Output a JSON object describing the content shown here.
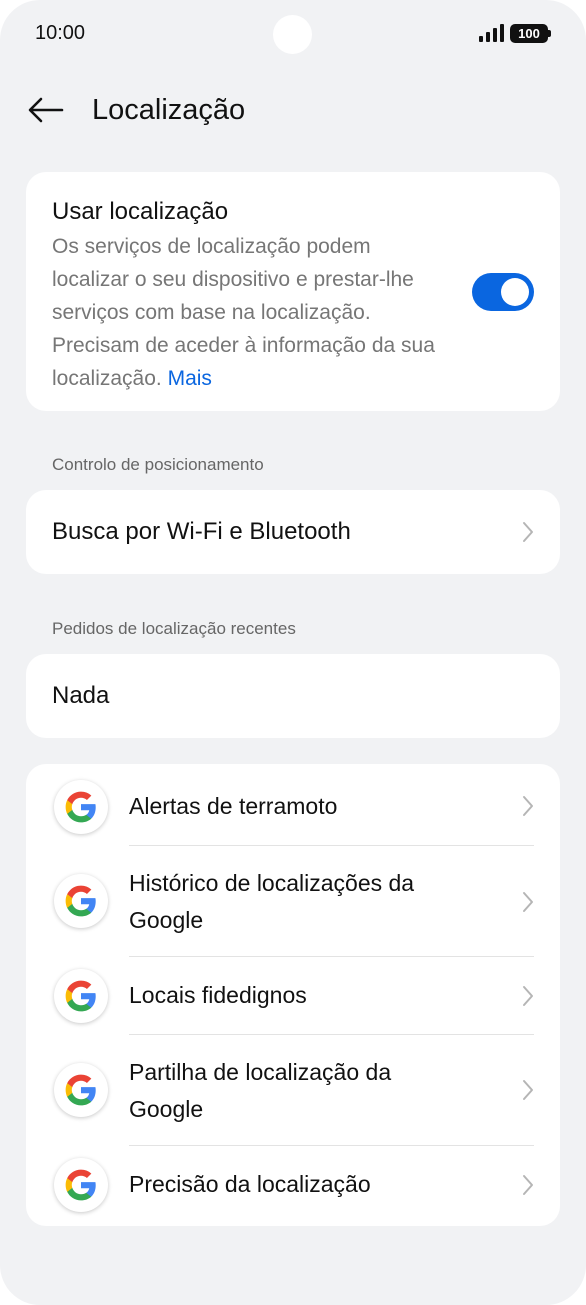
{
  "status_bar": {
    "time": "10:00",
    "battery": "100"
  },
  "header": {
    "title": "Localização"
  },
  "location_card": {
    "title": "Usar localização",
    "description": "Os serviços de localização podem localizar o seu dispositivo e prestar-lhe serviços com base na localização. Precisam de aceder à informação da sua localização.",
    "more_link": "Mais",
    "toggle_on": true
  },
  "sections": {
    "positioning_control": "Controlo de posicionamento",
    "recent_requests": "Pedidos de localização recentes"
  },
  "wifi_bluetooth_label": "Busca por Wi-Fi e Bluetooth",
  "recent_none_label": "Nada",
  "google_services": [
    {
      "label": "Alertas de terramoto"
    },
    {
      "label": "Histórico de localizações da Google"
    },
    {
      "label": "Locais fidedignos"
    },
    {
      "label": "Partilha de localização da Google"
    },
    {
      "label": "Precisão da localização"
    }
  ],
  "colors": {
    "accent": "#0a66e0",
    "background": "#f1f2f4",
    "card": "#ffffff"
  }
}
